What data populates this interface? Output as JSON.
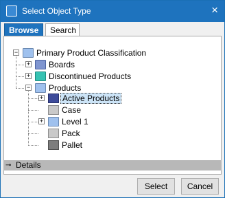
{
  "window": {
    "title": "Select Object Type",
    "close_glyph": "×"
  },
  "tabs": [
    {
      "label": "Browse",
      "active": true
    },
    {
      "label": "Search",
      "active": false
    }
  ],
  "tree": {
    "root": {
      "label": "Primary Product Classification",
      "icon": "folder-icon",
      "expanded": true
    },
    "children": [
      {
        "label": "Boards",
        "icon": "folder-icon",
        "expandable": true,
        "expanded": false
      },
      {
        "label": "Discontinued Products",
        "icon": "folder-icon",
        "expandable": true,
        "expanded": false
      },
      {
        "label": "Products",
        "icon": "folder-icon",
        "expandable": true,
        "expanded": true,
        "children": [
          {
            "label": "Active Products",
            "icon": "product-box-icon",
            "expandable": true,
            "expanded": false,
            "selected": true
          },
          {
            "label": "Case",
            "icon": "box-icon",
            "expandable": false
          },
          {
            "label": "Level 1",
            "icon": "folder-icon",
            "expandable": true,
            "expanded": false
          },
          {
            "label": "Pack",
            "icon": "box-icon",
            "expandable": false
          },
          {
            "label": "Pallet",
            "icon": "box-icon",
            "expandable": false
          }
        ]
      }
    ]
  },
  "details": {
    "label": "Details",
    "icon": "key-icon"
  },
  "buttons": {
    "select": "Select",
    "cancel": "Cancel"
  }
}
